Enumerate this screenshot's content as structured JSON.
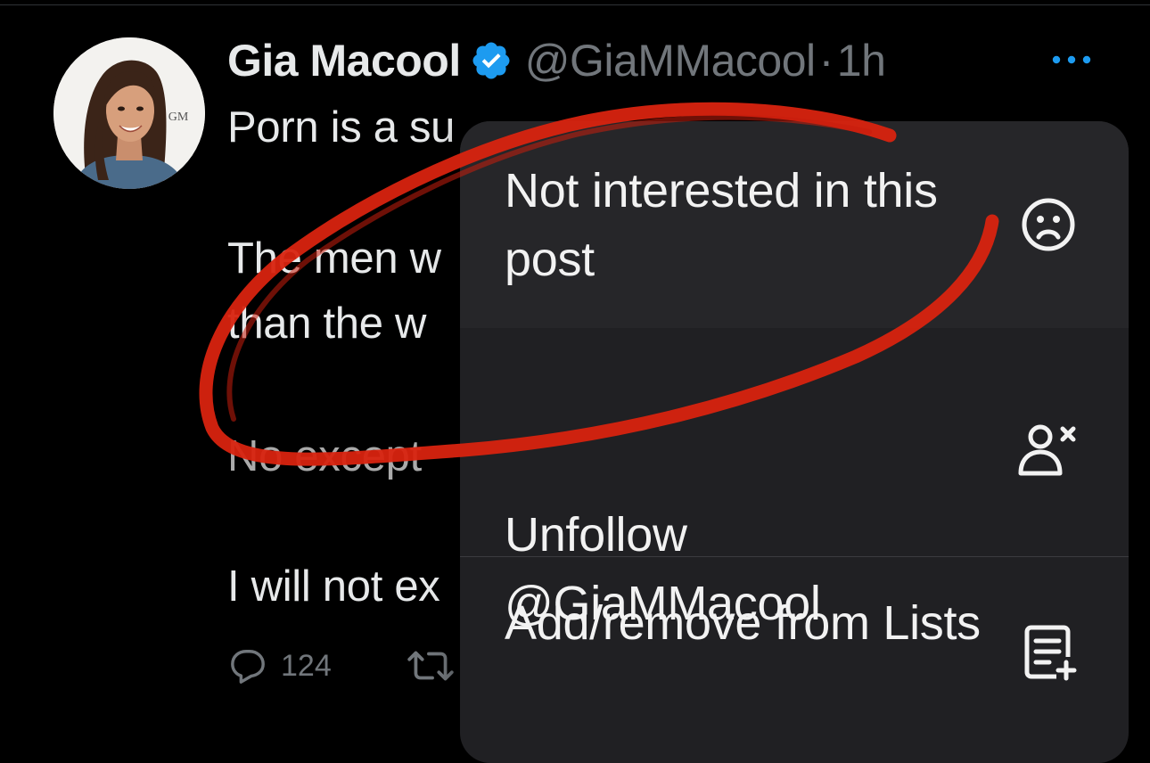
{
  "post": {
    "author_name": "Gia Macool",
    "handle": "@GiaMMacool",
    "separator": "·",
    "time": "1h",
    "avatar_monogram": "GM",
    "lines": [
      "Porn is a su",
      "The men w",
      "than the w",
      "No except",
      "I will not ex"
    ],
    "reply_count": "124"
  },
  "menu": {
    "items": [
      {
        "label": "Not interested in this post",
        "icon": "frown-face-icon"
      },
      {
        "label": "Unfollow @GiaMMacool",
        "icon": "unfollow-user-icon"
      },
      {
        "label": "Add/remove from Lists",
        "icon": "list-add-icon"
      }
    ]
  },
  "colors": {
    "background": "#000000",
    "menu_background": "#202023",
    "verified_blue": "#1d9bf0",
    "secondary_text": "#71767b",
    "primary_text": "#e7e9ea",
    "scribble_red": "#d8230f"
  }
}
